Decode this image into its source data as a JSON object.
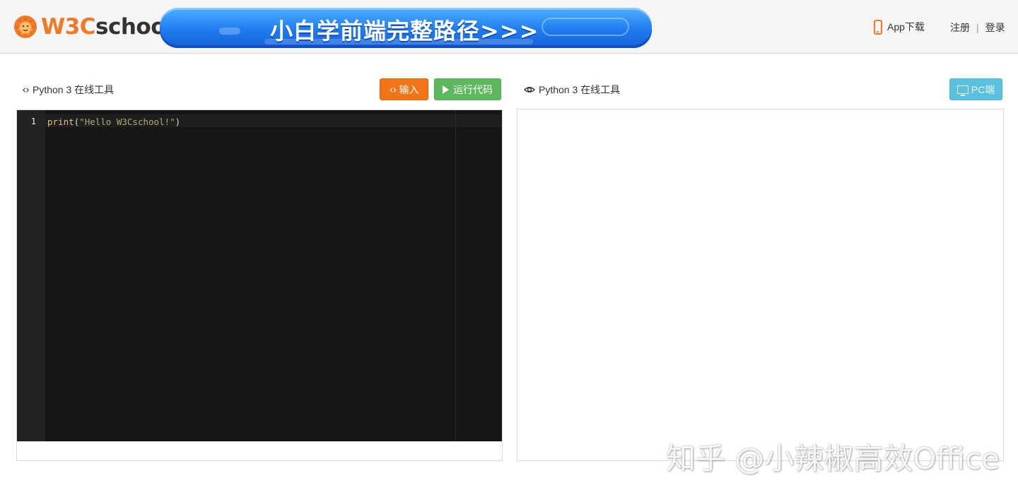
{
  "header": {
    "logo": {
      "part1": "W3C",
      "part2": "school"
    },
    "banner_text": "小白学前端完整路径>>>",
    "app_download": "App下载",
    "register": "注册",
    "separator": "|",
    "login": "登录"
  },
  "editor_panel": {
    "title": "Python 3 在线工具",
    "input_button": "输入",
    "run_button": "运行代码",
    "line_numbers": [
      "1"
    ],
    "code": {
      "fn": "print",
      "open": "(",
      "str": "\"Hello W3Cschool!\"",
      "close": ")"
    }
  },
  "output_panel": {
    "title": "Python 3 在线工具",
    "pc_button": "PC端"
  },
  "watermark": "知乎 @小辣椒高效Office",
  "colors": {
    "brand_orange": "#f27826",
    "run_green": "#5cb85c",
    "pc_blue": "#5bc0de",
    "editor_bg": "#161616"
  }
}
